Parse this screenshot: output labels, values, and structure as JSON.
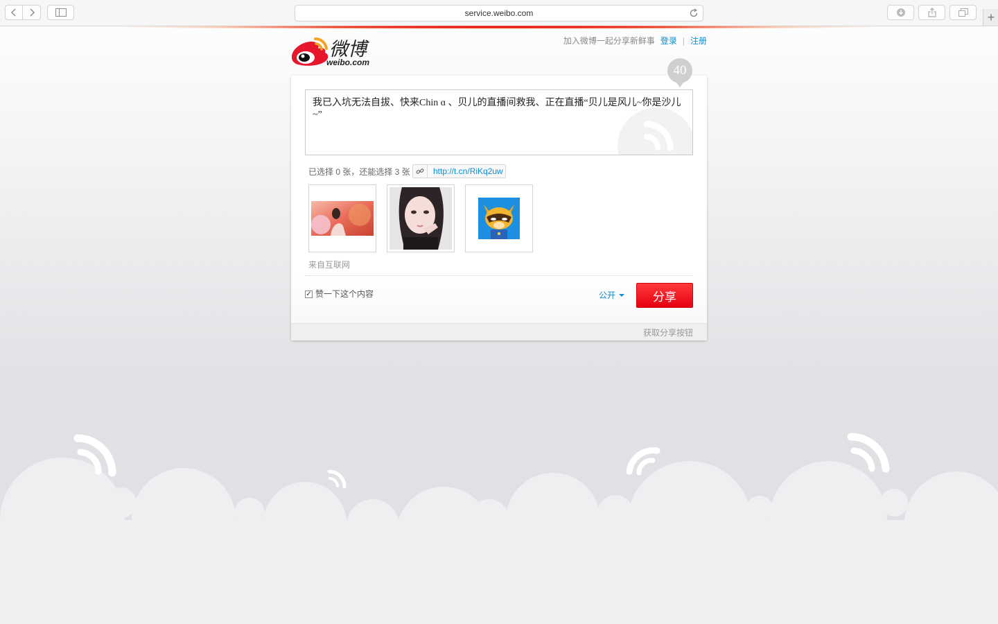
{
  "browser": {
    "url": "service.weibo.com"
  },
  "header": {
    "tagline": "加入微博一起分享新鲜事",
    "login": "登录",
    "separator": "|",
    "register": "注册",
    "logo_cn": "微博",
    "logo_en": "weibo.com"
  },
  "composer": {
    "remaining_count": "40",
    "text": "我已入坑无法自拔、快来Chin ɑ 、贝儿的直播间救我、正在直播“贝儿是风儿~你是沙儿~”",
    "selected_info": "已选择 0 张，还能选择 3 张",
    "short_url": "http://t.cn/RiKq2uw",
    "source": "来自互联网"
  },
  "footer": {
    "like_label": "赞一下这个内容",
    "like_checked": true,
    "visibility": "公开",
    "share_button": "分享",
    "get_share_button": "获取分享按钮"
  },
  "colors": {
    "accent_red": "#e60012",
    "link_blue": "#0a8cd2"
  },
  "icons": [
    "back-icon",
    "forward-icon",
    "sidebar-icon",
    "reload-icon",
    "download-icon",
    "share-icon",
    "tabs-icon",
    "plus-icon",
    "link-icon",
    "checkmark-icon",
    "caret-down-icon"
  ]
}
